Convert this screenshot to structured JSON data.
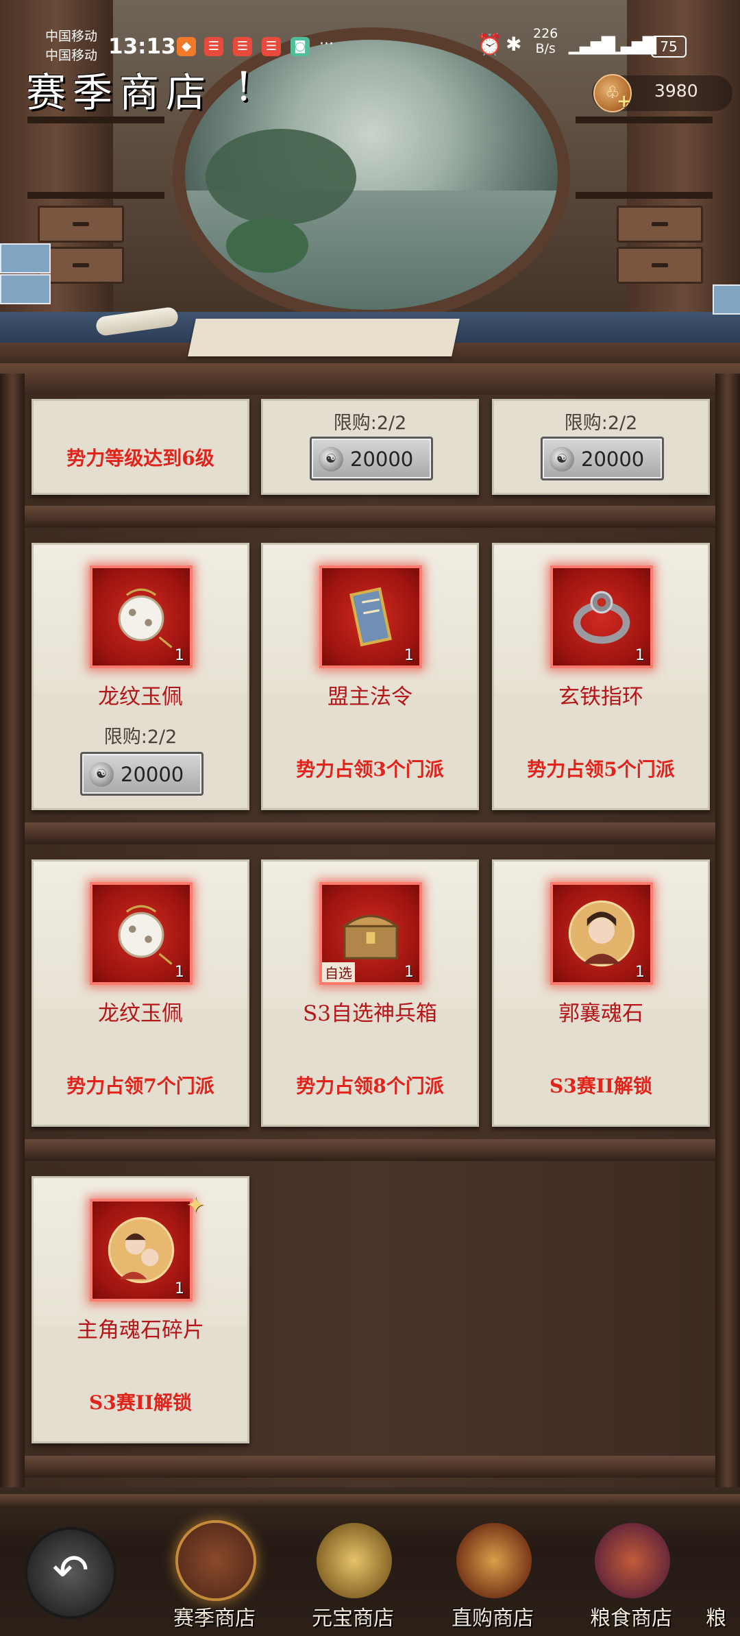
{
  "status_bar": {
    "carrier1": "中国移动",
    "carrier2": "中国移动",
    "time": "13:13",
    "speed_value": "226",
    "speed_unit": "B/s",
    "battery": "75"
  },
  "header": {
    "title": "赛季商店",
    "title_mark": "!",
    "currency_value": "3980"
  },
  "partial_row": {
    "card1_condition": "势力等级达到6级",
    "card2_limit": "限购:2/2",
    "card2_price": "20000",
    "card3_limit": "限购:2/2",
    "card3_price": "20000"
  },
  "items": [
    {
      "name": "龙纹玉佩",
      "qty": "1",
      "limit": "限购:2/2",
      "price": "20000",
      "condition": ""
    },
    {
      "name": "盟主法令",
      "qty": "1",
      "limit": "",
      "price": "",
      "condition": "势力占领3个门派"
    },
    {
      "name": "玄铁指环",
      "qty": "1",
      "limit": "",
      "price": "",
      "condition": "势力占领5个门派"
    },
    {
      "name": "龙纹玉佩",
      "qty": "1",
      "limit": "",
      "price": "",
      "condition": "势力占领7个门派"
    },
    {
      "name": "S3自选神兵箱",
      "qty": "1",
      "badge": "自选",
      "limit": "",
      "price": "",
      "condition": "势力占领8个门派"
    },
    {
      "name": "郭襄魂石",
      "qty": "1",
      "limit": "",
      "price": "",
      "condition": "S3赛II解锁"
    },
    {
      "name": "主角魂石碎片",
      "qty": "1",
      "limit": "",
      "price": "",
      "condition": "S3赛II解锁"
    }
  ],
  "nav": {
    "tabs": [
      {
        "label": "赛季商店",
        "active": true
      },
      {
        "label": "元宝商店",
        "active": false
      },
      {
        "label": "直购商店",
        "active": false
      },
      {
        "label": "粮食商店",
        "active": false
      },
      {
        "label": "粮",
        "active": false
      }
    ]
  },
  "colors": {
    "condition_red": "#e0241c",
    "name_red": "#b4161a",
    "card_bg": "#e3ded0",
    "cabinet_wood": "#4a3428"
  }
}
